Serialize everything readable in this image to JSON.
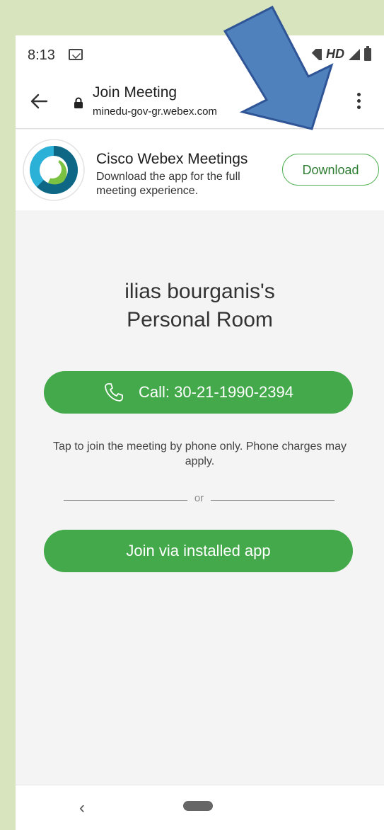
{
  "status_bar": {
    "time": "8:13",
    "hd_label": "HD"
  },
  "url_bar": {
    "title": "Join Meeting",
    "domain": "minedu-gov-gr.webex.com"
  },
  "app_banner": {
    "title": "Cisco Webex Meetings",
    "description": "Download the app for the full meeting experience.",
    "download_label": "Download"
  },
  "meeting": {
    "room_line1": "ilias bourganis's",
    "room_line2": "Personal Room",
    "call_label": "Call: 30-21-1990-2394",
    "tap_note": "Tap to join the meeting by phone only. Phone charges may apply.",
    "or_label": "or",
    "join_app_label": "Join via installed app"
  },
  "nav_bar": {
    "back_glyph": "‹"
  },
  "colors": {
    "page_background": "#d7e4bd",
    "accent_green": "#43a94a",
    "arrow_blue": "#4f81bd"
  }
}
